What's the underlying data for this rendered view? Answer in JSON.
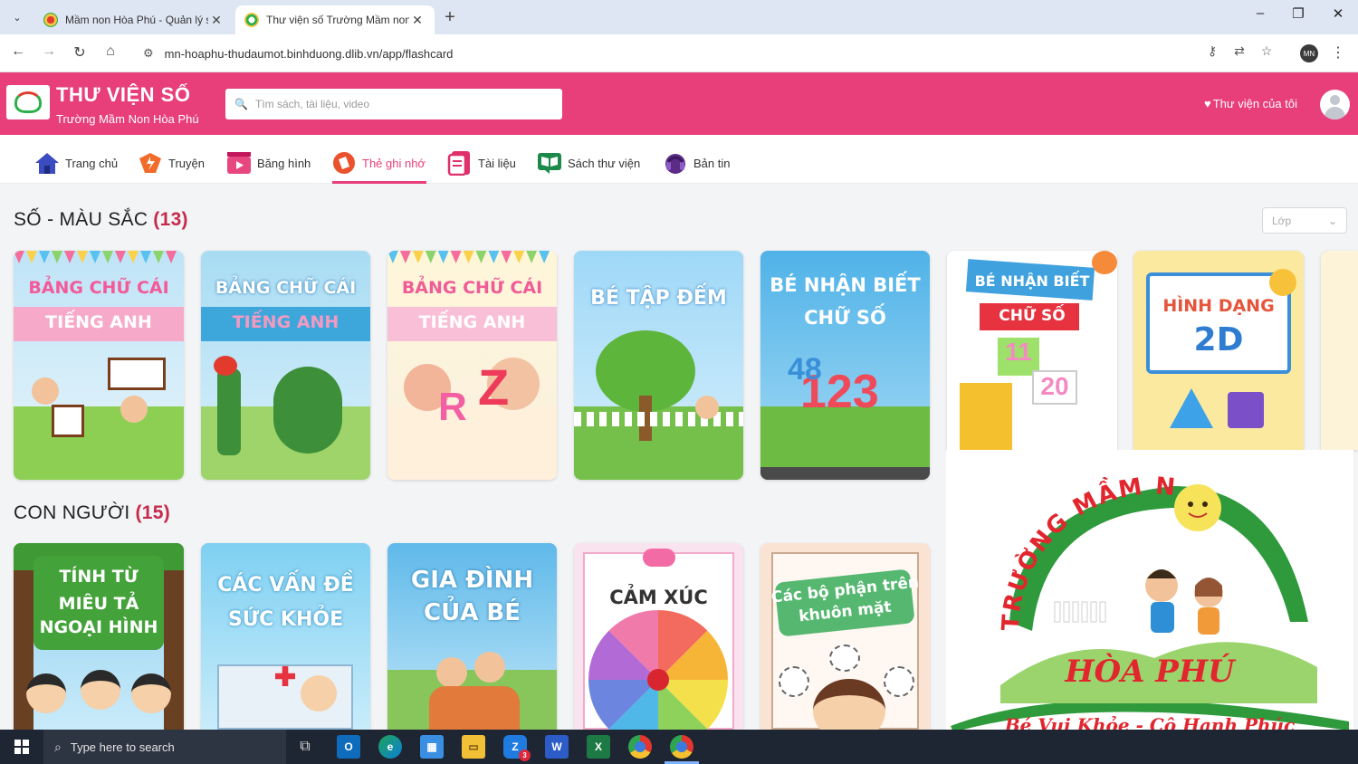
{
  "browser": {
    "tabs": [
      {
        "title": "Mầm non Hòa Phú - Quản lý sổ",
        "active": false
      },
      {
        "title": "Thư viện số Trường Mầm non H",
        "active": true
      }
    ],
    "new_tab": "+",
    "url": "mn-hoaphu-thudaumot.binhduong.dlib.vn/app/flashcard",
    "profile_initials": "MN",
    "window_controls": [
      "–",
      "❐",
      "✕"
    ]
  },
  "header": {
    "title": "THƯ VIỆN SỐ",
    "subtitle": "Trường Mầm Non Hòa Phú",
    "search_placeholder": "Tìm sách, tài liệu, video",
    "my_library": "Thư viện của tôi",
    "accent_color": "#e83e7a"
  },
  "menu": {
    "items": [
      {
        "label": "Trang chủ",
        "icon": "home-icon"
      },
      {
        "label": "Truyện",
        "icon": "story-icon"
      },
      {
        "label": "Băng hình",
        "icon": "video-icon"
      },
      {
        "label": "Thẻ ghi nhớ",
        "icon": "flashcard-icon",
        "active": true
      },
      {
        "label": "Tài liệu",
        "icon": "document-icon"
      },
      {
        "label": "Sách thư viện",
        "icon": "book-icon"
      },
      {
        "label": "Bản tin",
        "icon": "news-icon"
      }
    ]
  },
  "sections": [
    {
      "title": "SỐ - MÀU SẮC",
      "count": "(13)",
      "filter_label": "Lớp",
      "cards": [
        {
          "line1": "BẢNG CHỮ CÁI",
          "line2": "TIẾNG ANH"
        },
        {
          "line1": "BẢNG CHỮ CÁI",
          "line2": "TIẾNG ANH"
        },
        {
          "line1": "BẢNG CHỮ CÁI",
          "line2": "TIẾNG ANH"
        },
        {
          "line1": "BÉ TẬP ĐẾM",
          "line2": ""
        },
        {
          "line1": "BÉ NHẬN BIẾT",
          "line2": "CHỮ SỐ"
        },
        {
          "line1": "BÉ NHẬN BIẾT",
          "line2": "CHỮ SỐ"
        },
        {
          "line1": "HÌNH DẠNG",
          "line2": "2D"
        }
      ]
    },
    {
      "title": "CON NGƯỜI",
      "count": "(15)",
      "cards": [
        {
          "line1": "TÍNH TỪ MIÊU TẢ",
          "line2": "NGOẠI HÌNH"
        },
        {
          "line1": "CÁC VẤN ĐỀ",
          "line2": "SỨC KHỎE"
        },
        {
          "line1": "GIA ĐÌNH",
          "line2": "CỦA BÉ"
        },
        {
          "line1": "CẢM XÚC",
          "line2": ""
        },
        {
          "line1": "Các bộ phận trên",
          "line2": "khuôn mặt"
        }
      ]
    }
  ],
  "overlay_logo": {
    "arc_text": "TRƯỜNG MẦM NON",
    "name": "HÒA PHÚ",
    "slogan": "Bé Vui Khỏe - Cô Hạnh Phúc"
  },
  "taskbar": {
    "search_placeholder": "Type here to search",
    "apps": [
      "task-view",
      "outlook",
      "edge",
      "store",
      "explorer",
      "zalo",
      "word",
      "excel",
      "chrome-l",
      "chrome-mn"
    ],
    "zalo_badge": "3"
  }
}
